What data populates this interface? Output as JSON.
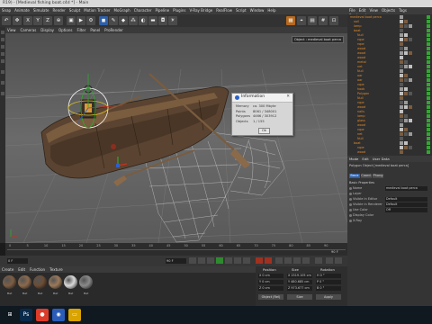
{
  "window": {
    "title": "R19) - [Medieval fishing boat.c4d *] - Main"
  },
  "menubar": [
    "Snap",
    "Animate",
    "Simulate",
    "Render",
    "Sculpt",
    "Motion Tracker",
    "MoGraph",
    "Character",
    "Pipeline",
    "Plugins",
    "V-Ray Bridge",
    "RealFlow",
    "Script",
    "Window",
    "Help"
  ],
  "toolbar": {
    "axis_buttons": [
      "X",
      "Y",
      "Z"
    ]
  },
  "viewport": {
    "menu": [
      "View",
      "Cameras",
      "Display",
      "Options",
      "Filter",
      "Panel",
      "ProRender"
    ],
    "tooltip": "Object : medieval boat perca"
  },
  "info_dialog": {
    "title": "Information",
    "rows": [
      {
        "k": "Memory",
        "v": "ca. 300 Mbyte"
      },
      {
        "k": "Points",
        "v": "8061 / 348001"
      },
      {
        "k": "Polygons",
        "v": "4466 / 303912"
      },
      {
        "k": "Objects",
        "v": "1 / 155"
      }
    ],
    "ok_label": "Ok"
  },
  "timeline": {
    "ticks": [
      "0",
      "5",
      "10",
      "15",
      "20",
      "25",
      "30",
      "35",
      "40",
      "45",
      "50",
      "55",
      "60",
      "65",
      "70",
      "75",
      "80",
      "85",
      "90"
    ],
    "frame_label": "90 F"
  },
  "transport": {
    "start_field": "0 F",
    "end_field": "90 F"
  },
  "materials": {
    "menu": [
      "Create",
      "Edit",
      "Function",
      "Texture"
    ],
    "items": [
      {
        "name": "Mat",
        "color": "#7d5e44"
      },
      {
        "name": "Mat",
        "color": "#8c6a4c"
      },
      {
        "name": "Mat",
        "color": "#6b4d35"
      },
      {
        "name": "Mat",
        "color": "#9b7a5a"
      },
      {
        "name": "Mat",
        "color": "#d9d9d9"
      },
      {
        "name": "Mat",
        "color": "#8a8a8a"
      }
    ]
  },
  "coordinates": {
    "headers": [
      "Position",
      "Size",
      "Rotation"
    ],
    "rows": [
      [
        "X 0 cm",
        "X 1519.105 cm",
        "H 0 °"
      ],
      [
        "Y 0 cm",
        "Y 480.685 cm",
        "P 0 °"
      ],
      [
        "Z 0 cm",
        "Z 973.677 cm",
        "B 0 °"
      ]
    ],
    "mode": "Object (Rel)",
    "size_mode": "Size",
    "apply_label": "Apply"
  },
  "objects_panel": {
    "menu": [
      "File",
      "Edit",
      "View",
      "Objects",
      "Tags",
      "Bookmarks"
    ],
    "items": [
      {
        "name": "medieval boat perca",
        "indent": 0
      },
      {
        "name": "sail",
        "indent": 1
      },
      {
        "name": "lamp",
        "indent": 1
      },
      {
        "name": "boat",
        "indent": 1
      },
      {
        "name": "Null",
        "indent": 2
      },
      {
        "name": "rope",
        "indent": 2
      },
      {
        "name": "rope",
        "indent": 2
      },
      {
        "name": "wood",
        "indent": 2
      },
      {
        "name": "wood",
        "indent": 2
      },
      {
        "name": "wood",
        "indent": 2
      },
      {
        "name": "metal",
        "indent": 2
      },
      {
        "name": "net",
        "indent": 2
      },
      {
        "name": "Null",
        "indent": 2
      },
      {
        "name": "oar",
        "indent": 2
      },
      {
        "name": "oar",
        "indent": 2
      },
      {
        "name": "rope",
        "indent": 2
      },
      {
        "name": "hook",
        "indent": 2
      },
      {
        "name": "Polygon",
        "indent": 2
      },
      {
        "name": "Null",
        "indent": 2
      },
      {
        "name": "rope",
        "indent": 2
      },
      {
        "name": "wood",
        "indent": 2
      },
      {
        "name": "nails",
        "indent": 2
      },
      {
        "name": "lamp",
        "indent": 2
      },
      {
        "name": "glass",
        "indent": 2
      },
      {
        "name": "wood",
        "indent": 2
      },
      {
        "name": "rope",
        "indent": 2
      },
      {
        "name": "net",
        "indent": 2
      },
      {
        "name": "Null",
        "indent": 2
      },
      {
        "name": "boat",
        "indent": 1
      },
      {
        "name": "rope",
        "indent": 2
      },
      {
        "name": "wood",
        "indent": 2
      }
    ]
  },
  "attributes": {
    "menu": [
      "Mode",
      "Edit",
      "User Data"
    ],
    "title": "Polygon Object [medieval boat perca]",
    "tabs": [
      "Basic",
      "Coord.",
      "Phong"
    ],
    "section": "Basic Properties",
    "fields": [
      {
        "label": "Name",
        "value": "medieval boat perca"
      },
      {
        "label": "Layer",
        "value": ""
      },
      {
        "label": "Visible in Editor",
        "value": "Default"
      },
      {
        "label": "Visible in Renderer",
        "value": "Default"
      },
      {
        "label": "Use Color",
        "value": "Off"
      },
      {
        "label": "Display Color",
        "value": ""
      },
      {
        "label": "X-Ray",
        "value": ""
      }
    ]
  },
  "taskbar": {
    "apps": [
      {
        "name": "Ps",
        "color": "#0a2a4a",
        "glyph": "Ps"
      },
      {
        "name": "Chrome",
        "color": "#dd3b2a",
        "glyph": "●"
      },
      {
        "name": "Cinema 4D",
        "color": "#2b5cb8",
        "glyph": "◉"
      },
      {
        "name": "Explorer",
        "color": "#d9a300",
        "glyph": "▭"
      }
    ]
  }
}
